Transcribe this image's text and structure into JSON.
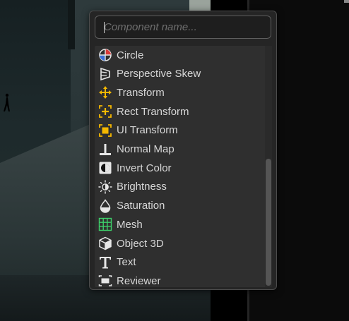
{
  "search": {
    "placeholder": "Component name..."
  },
  "components": [
    {
      "label": "Circle",
      "icon": "circle-icon"
    },
    {
      "label": "Perspective Skew",
      "icon": "perspective-skew-icon"
    },
    {
      "label": "Transform",
      "icon": "transform-arrows-icon"
    },
    {
      "label": "Rect Transform",
      "icon": "rect-transform-icon"
    },
    {
      "label": "UI Transform",
      "icon": "ui-transform-icon"
    },
    {
      "label": "Normal Map",
      "icon": "normal-map-icon"
    },
    {
      "label": "Invert Color",
      "icon": "invert-color-icon"
    },
    {
      "label": "Brightness",
      "icon": "brightness-icon"
    },
    {
      "label": "Saturation",
      "icon": "saturation-icon"
    },
    {
      "label": "Mesh",
      "icon": "mesh-grid-icon"
    },
    {
      "label": "Object 3D",
      "icon": "cube-icon"
    },
    {
      "label": "Text",
      "icon": "text-t-icon"
    },
    {
      "label": "Reviewer",
      "icon": "reviewer-icon"
    }
  ],
  "colors": {
    "accent_yellow": "#f5b800",
    "mesh_green": "#3dd06a",
    "circle_red": "#d93a3a",
    "circle_blue": "#3a6fd9"
  }
}
